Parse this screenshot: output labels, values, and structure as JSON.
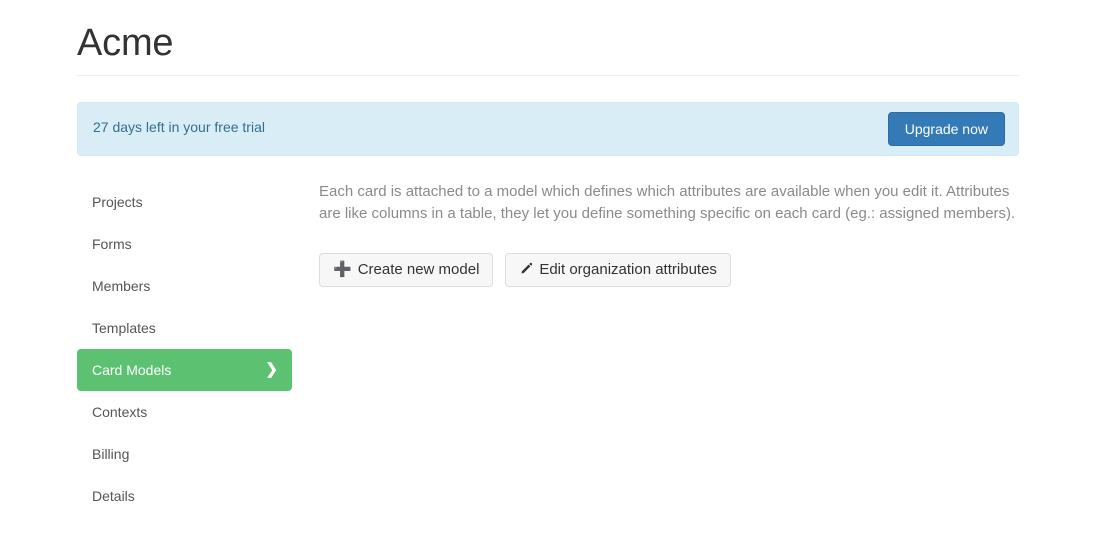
{
  "header": {
    "title": "Acme"
  },
  "trial": {
    "message": "27 days left in your free trial",
    "upgrade_label": "Upgrade now",
    "banner_color": "#d9edf7",
    "text_color": "#31708f",
    "button_color": "#337ab7"
  },
  "sidebar": {
    "active_color": "#5cc271",
    "items": [
      {
        "label": "Projects",
        "active": false
      },
      {
        "label": "Forms",
        "active": false
      },
      {
        "label": "Members",
        "active": false
      },
      {
        "label": "Templates",
        "active": false
      },
      {
        "label": "Card Models",
        "active": true,
        "chevron": "chevron-right-icon"
      },
      {
        "label": "Contexts",
        "active": false
      },
      {
        "label": "Billing",
        "active": false
      },
      {
        "label": "Details",
        "active": false
      }
    ]
  },
  "main": {
    "description": "Each card is attached to a model which defines which attributes are available when you edit it. Attributes are like columns in a table, they let you define something specific on each card (eg.: assigned members).",
    "buttons": [
      {
        "label": "Create new model",
        "icon": "plus-icon"
      },
      {
        "label": "Edit organization attributes",
        "icon": "pencil-icon"
      }
    ]
  }
}
